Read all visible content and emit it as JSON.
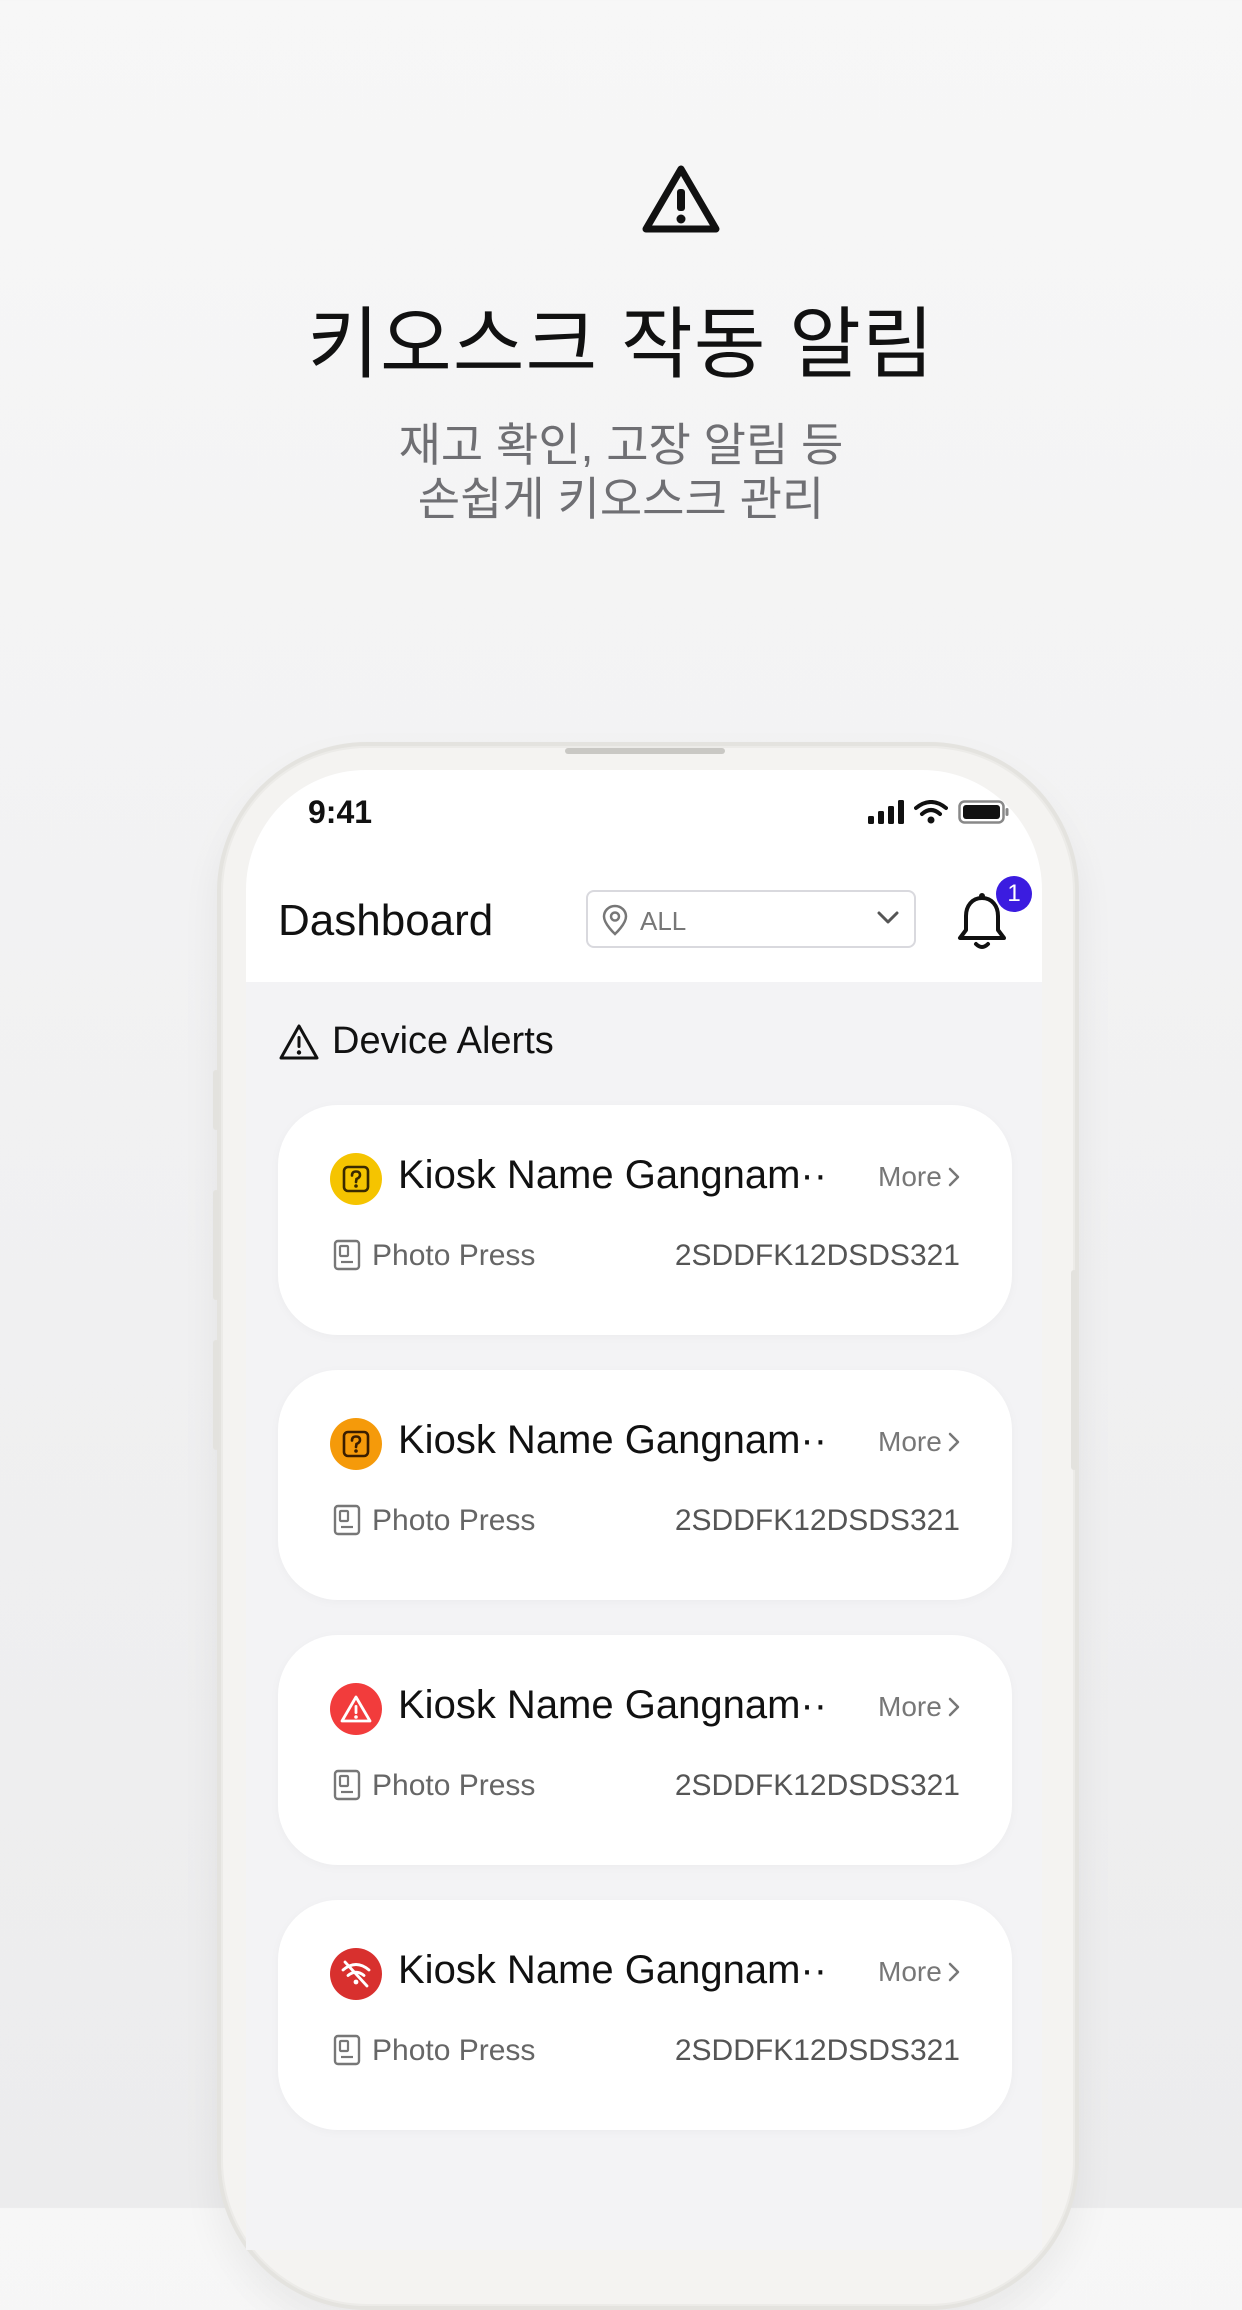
{
  "promo": {
    "icon": "warning-triangle-icon",
    "title": "키오스크 작동 알림",
    "subtitle_line1": "재고 확인, 고장 알림 등",
    "subtitle_line2": "손쉽게 키오스크 관리"
  },
  "status_bar": {
    "time": "9:41",
    "icons": [
      "cellular-signal-icon",
      "wifi-icon",
      "battery-icon"
    ]
  },
  "header": {
    "title": "Dashboard",
    "location_filter": {
      "icon": "location-pin-icon",
      "value": "ALL"
    },
    "notifications": {
      "icon": "bell-icon",
      "badge_count": "1"
    }
  },
  "section": {
    "icon": "warning-triangle-icon",
    "title": "Device Alerts"
  },
  "alerts": [
    {
      "status_icon": "question-box-icon",
      "status_color": "#F5C400",
      "name": "Kiosk Name Gangnam···",
      "more_label": "More",
      "product_icon": "kiosk-device-icon",
      "product": "Photo Press",
      "serial": "2SDDFK12DSDS321"
    },
    {
      "status_icon": "question-box-icon",
      "status_color": "#F59A0A",
      "name": "Kiosk Name Gangnam···",
      "more_label": "More",
      "product_icon": "kiosk-device-icon",
      "product": "Photo Press",
      "serial": "2SDDFK12DSDS321"
    },
    {
      "status_icon": "warning-triangle-icon",
      "status_color": "#F23C3C",
      "name": "Kiosk Name Gangnam···",
      "more_label": "More",
      "product_icon": "kiosk-device-icon",
      "product": "Photo Press",
      "serial": "2SDDFK12DSDS321"
    },
    {
      "status_icon": "wifi-off-icon",
      "status_color": "#D8302E",
      "name": "Kiosk Name Gangnam···",
      "more_label": "More",
      "product_icon": "kiosk-device-icon",
      "product": "Photo Press",
      "serial": "2SDDFK12DSDS321"
    }
  ],
  "colors": {
    "badge": "#3B1CE0",
    "text_primary": "#111111",
    "text_secondary": "#6F6F73"
  }
}
